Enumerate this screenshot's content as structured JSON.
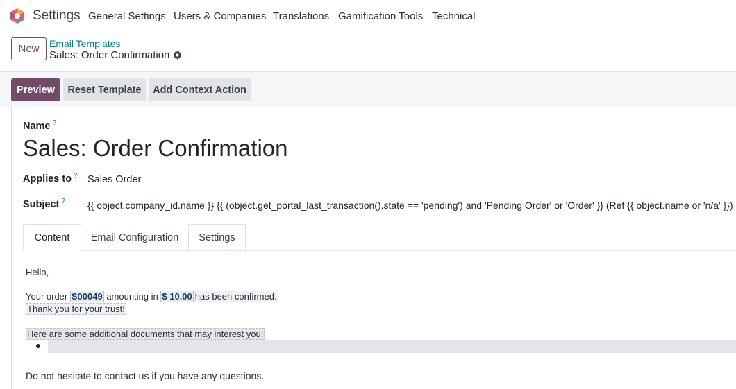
{
  "navbar": {
    "app_title": "Settings",
    "items": [
      "General Settings",
      "Users & Companies",
      "Translations",
      "Gamification Tools",
      "Technical"
    ]
  },
  "control_panel": {
    "new_label": "New",
    "breadcrumb_parent": "Email Templates",
    "breadcrumb_current": "Sales: Order Confirmation"
  },
  "actions": {
    "preview": "Preview",
    "reset_template": "Reset Template",
    "add_context_action": "Add Context Action"
  },
  "form": {
    "name_label": "Name",
    "help_mark": "?",
    "name_value": "Sales: Order Confirmation",
    "applies_to_label": "Applies to",
    "applies_to_value": "Sales Order",
    "subject_label": "Subject",
    "subject_value": "{{ object.company_id.name }} {{ (object.get_portal_last_transaction().state == 'pending') and 'Pending Order' or 'Order' }} (Ref {{ object.name or 'n/a' }})"
  },
  "tabs": [
    "Content",
    "Email Configuration",
    "Settings"
  ],
  "content": {
    "greeting": "Hello,",
    "order_prefix": "Your order",
    "order_ref": "S00049",
    "amount_text": "amounting in",
    "amount": "$ 10.00",
    "confirmed": "has been confirmed.",
    "thanks": "Thank you for your trust!",
    "docs": "Here are some additional documents that may interest you:",
    "closing": "Do not hesitate to contact us if you have any questions."
  }
}
